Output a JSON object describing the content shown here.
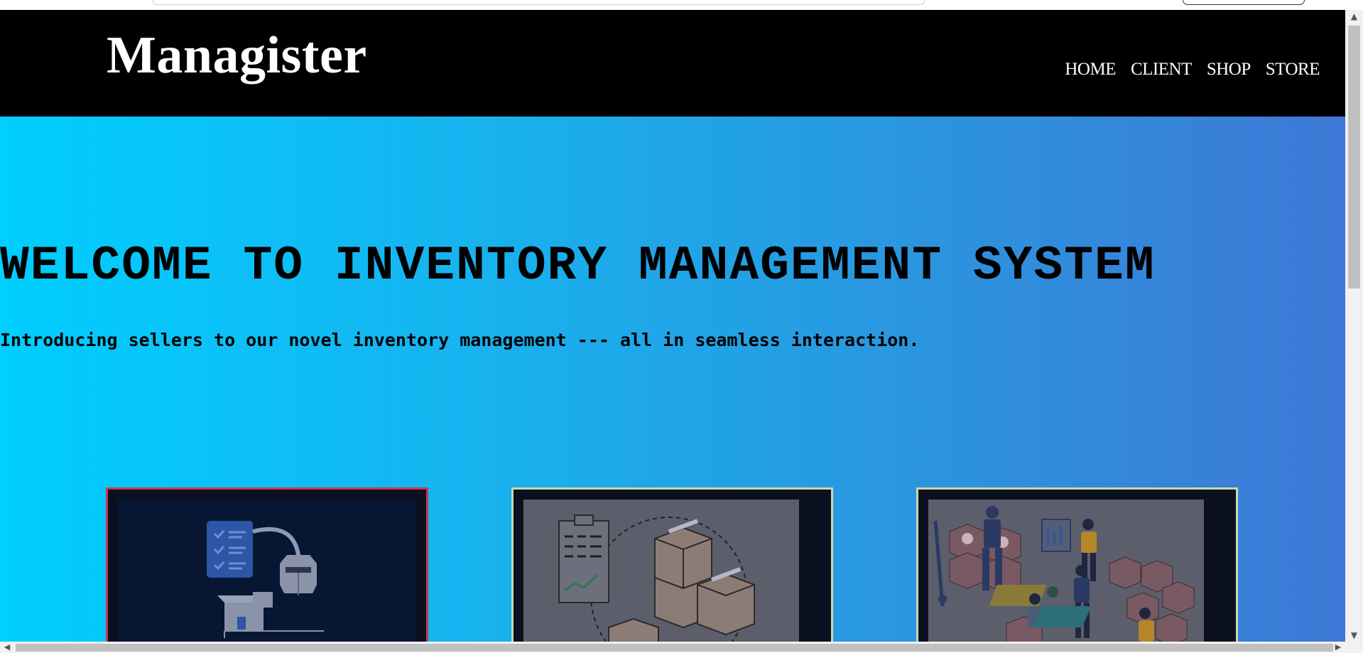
{
  "header": {
    "logo": "Managister",
    "nav": [
      "HOME",
      "CLIENT",
      "SHOP",
      "STORE"
    ]
  },
  "hero": {
    "title": "WELCOME TO INVENTORY MANAGEMENT SYSTEM",
    "subtitle": "Introducing sellers to our novel inventory management --- all in seamless interaction."
  },
  "cards": [
    {
      "image": "inventory-checklist-icon",
      "border_color": "#c8374f"
    },
    {
      "image": "clipboard-boxes-icon",
      "border_color": "#c9d9a8"
    },
    {
      "image": "warehouse-robot-icon",
      "border_color": "#c9d9a8"
    }
  ],
  "colors": {
    "header_bg": "#000000",
    "hero_gradient_start": "#00cfff",
    "hero_gradient_end": "#3d78d6",
    "card_bg": "#0b1020"
  }
}
